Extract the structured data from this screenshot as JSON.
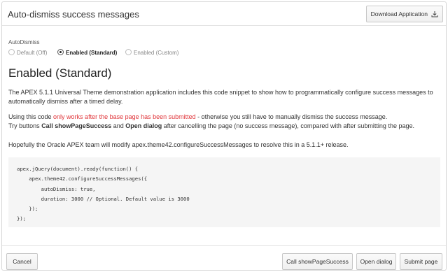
{
  "header": {
    "title": "Auto-dismiss success messages",
    "download_label": "Download Application"
  },
  "radio_group": {
    "label": "AutoDismiss",
    "options": [
      {
        "label": "Default (Off)",
        "selected": false
      },
      {
        "label": "Enabled (Standard)",
        "selected": true
      },
      {
        "label": "Enabled (Custom)",
        "selected": false
      }
    ]
  },
  "content": {
    "heading": "Enabled (Standard)",
    "para1": "The APEX 5.1.1 Universal Theme demonstration application includes this code snippet to show how to programmatically configure success messages to automatically dismiss after a timed delay.",
    "para2_start": "Using this code ",
    "para2_highlight": "only works after the base page has been submitted",
    "para2_end": " - otherwise you still have to manually dismiss the success message.",
    "para2_line2_start": "Try buttons ",
    "para2_bold1": "Call showPageSuccess",
    "para2_mid": " and ",
    "para2_bold2": "Open dialog",
    "para2_line2_end": " after cancelling the page (no success message), compared with after submitting the page.",
    "para3": "Hopefully the Oracle APEX team will modify apex.theme42.configureSuccessMessages to resolve this in a 5.1.1+ release.",
    "code": "apex.jQuery(document).ready(function() {\n    apex.theme42.configureSuccessMessages({\n        autoDismiss: true,\n        duration: 3000 // Optional. Default value is 3000\n    });\n});"
  },
  "footer": {
    "cancel_label": "Cancel",
    "show_success_label": "Call showPageSuccess",
    "open_dialog_label": "Open dialog",
    "submit_label": "Submit page"
  },
  "colors": {
    "highlight": "#e0353a"
  },
  "icons": {
    "download": "download-icon"
  }
}
